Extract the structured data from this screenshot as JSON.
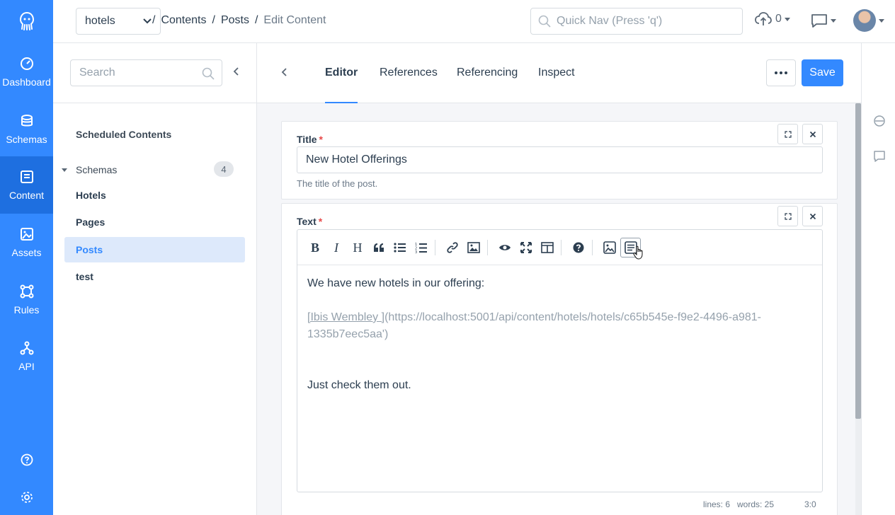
{
  "nav": {
    "items": [
      {
        "label": "Dashboard",
        "icon": "dashboard-icon"
      },
      {
        "label": "Schemas",
        "icon": "schemas-icon"
      },
      {
        "label": "Content",
        "icon": "content-icon"
      },
      {
        "label": "Assets",
        "icon": "assets-icon"
      },
      {
        "label": "Rules",
        "icon": "rules-icon"
      },
      {
        "label": "API",
        "icon": "api-icon"
      }
    ]
  },
  "topbar": {
    "app": "hotels",
    "breadcrumb": [
      "Contents",
      "Posts",
      "Edit Content"
    ],
    "quicknav_placeholder": "Quick Nav (Press 'q')",
    "uploads_count": "0"
  },
  "sidebar": {
    "search_placeholder": "Search",
    "scheduled": "Scheduled Contents",
    "schemas_label": "Schemas",
    "schemas_count": "4",
    "items": [
      "Hotels",
      "Pages",
      "Posts",
      "test"
    ]
  },
  "tabs": [
    "Editor",
    "References",
    "Referencing",
    "Inspect"
  ],
  "save_label": "Save",
  "title_field": {
    "label": "Title",
    "required": "*",
    "value": "New Hotel Offerings",
    "hint": "The title of the post."
  },
  "text_field": {
    "label": "Text",
    "required": "*",
    "line1": "We have new hotels in our offering:",
    "link_label": "[Ibis Wembley ]",
    "link_url_1": "(https://localhost:5001/api/content/hotels/hotels/c65b545e-f9e2-4496-a981-",
    "link_url_2": "1335b7eec5aa')",
    "line3": "Just check them out.",
    "status_lines": "lines: 6",
    "status_words": "words: 25",
    "status_cursor": "3:0"
  },
  "colors": {
    "accent": "#3389ff",
    "nav_active": "#1e6fe0",
    "required": "#e84a4a"
  }
}
